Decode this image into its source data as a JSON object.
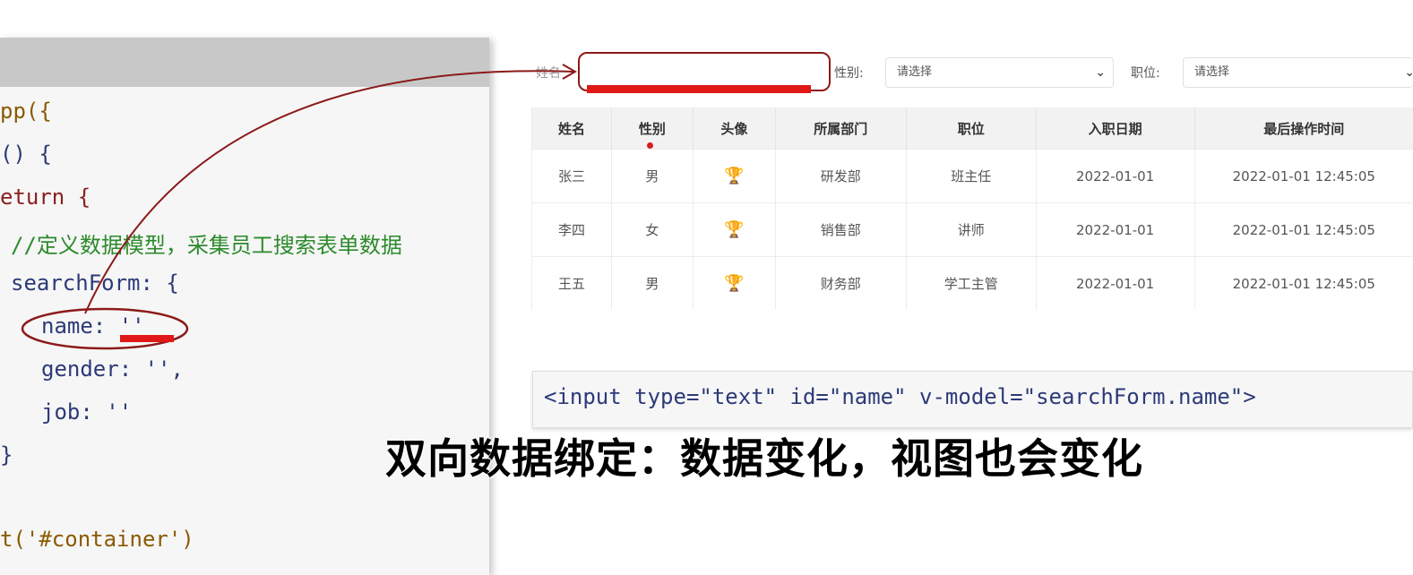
{
  "code": {
    "lines": [
      "pp({",
      "() {",
      "eturn {",
      "//定义数据模型，采集员工搜索表单数据",
      "searchForm: {",
      "name: ''",
      "gender: '',",
      "job: ''",
      "}",
      "t('#container')"
    ]
  },
  "form": {
    "name_label": "姓名",
    "gender_label": "性别:",
    "gender_placeholder": "请选择",
    "job_label": "职位:",
    "job_placeholder": "请选择"
  },
  "table": {
    "headers": [
      "姓名",
      "性别",
      "头像",
      "所属部门",
      "职位",
      "入职日期",
      "最后操作时间"
    ],
    "rows": [
      {
        "name": "张三",
        "gender": "男",
        "dept": "研发部",
        "job": "班主任",
        "entry": "2022-01-01",
        "updated": "2022-01-01 12:45:05"
      },
      {
        "name": "李四",
        "gender": "女",
        "dept": "销售部",
        "job": "讲师",
        "entry": "2022-01-01",
        "updated": "2022-01-01 12:45:05"
      },
      {
        "name": "王五",
        "gender": "男",
        "dept": "财务部",
        "job": "学工主管",
        "entry": "2022-01-01",
        "updated": "2022-01-01 12:45:05"
      }
    ]
  },
  "snippet": "<input type=\"text\" id=\"name\" v-model=\"searchForm.name\">",
  "caption": "双向数据绑定：数据变化，视图也会变化",
  "colors": {
    "annotation": "#8c1a1a",
    "highlight": "#e01818"
  }
}
